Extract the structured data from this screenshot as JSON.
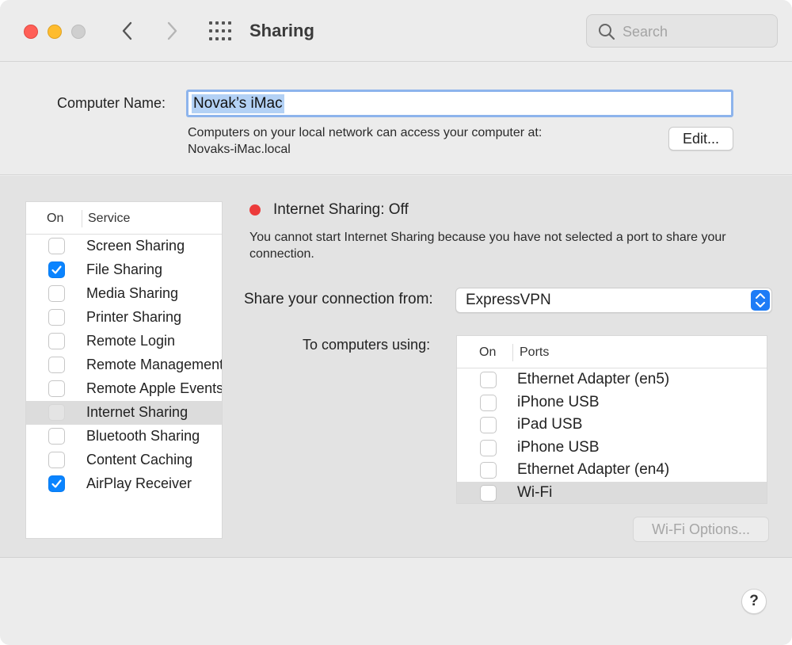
{
  "window": {
    "title": "Sharing",
    "search_placeholder": "Search"
  },
  "computer_name": {
    "label": "Computer Name:",
    "value": "Novak’s iMac",
    "description_line1": "Computers on your local network can access your computer at:",
    "description_line2": "Novaks-iMac.local",
    "edit_label": "Edit..."
  },
  "services": {
    "header_on": "On",
    "header_service": "Service",
    "items": [
      {
        "label": "Screen Sharing",
        "checked": false
      },
      {
        "label": "File Sharing",
        "checked": true
      },
      {
        "label": "Media Sharing",
        "checked": false
      },
      {
        "label": "Printer Sharing",
        "checked": false
      },
      {
        "label": "Remote Login",
        "checked": false
      },
      {
        "label": "Remote Management",
        "checked": false
      },
      {
        "label": "Remote Apple Events",
        "checked": false
      },
      {
        "label": "Internet Sharing",
        "checked": false,
        "selected": true
      },
      {
        "label": "Bluetooth Sharing",
        "checked": false
      },
      {
        "label": "Content Caching",
        "checked": false
      },
      {
        "label": "AirPlay Receiver",
        "checked": true
      }
    ]
  },
  "detail": {
    "status_title": "Internet Sharing: Off",
    "status_color": "#ec3b3b",
    "status_desc": "You cannot start Internet Sharing because you have not selected a port to share your connection.",
    "share_from_label": "Share your connection from:",
    "share_from_value": "ExpressVPN",
    "to_computers_label": "To computers using:",
    "ports_header_on": "On",
    "ports_header_ports": "Ports",
    "ports": [
      {
        "label": "Ethernet Adapter (en5)",
        "checked": false
      },
      {
        "label": "iPhone USB",
        "checked": false
      },
      {
        "label": "iPad USB",
        "checked": false
      },
      {
        "label": "iPhone USB",
        "checked": false
      },
      {
        "label": "Ethernet Adapter (en4)",
        "checked": false
      },
      {
        "label": "Wi-Fi",
        "checked": false,
        "selected": true
      }
    ],
    "wifi_options_label": "Wi-Fi Options..."
  },
  "help_label": "?"
}
